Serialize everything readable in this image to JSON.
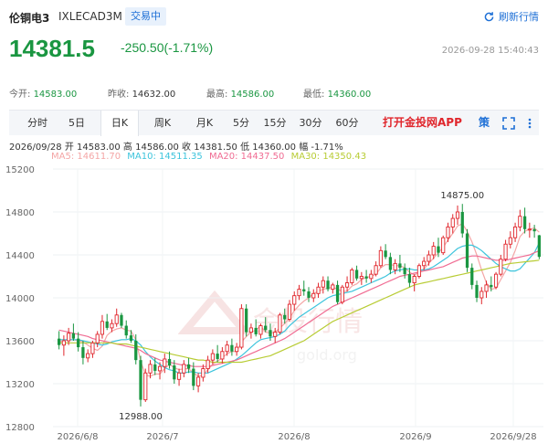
{
  "header": {
    "name": "伦铜电3",
    "code": "IXLECAD3M",
    "status": "交易中",
    "refresh_label": "刷新行情",
    "price": "14381.5",
    "change": "-250.50(-1.71%)",
    "time": "2026-09-28 15:40:43"
  },
  "stats": [
    {
      "label": "今开:",
      "value": "14583.00",
      "color": "#1a9641"
    },
    {
      "label": "昨收:",
      "value": "14632.00",
      "color": "#333333"
    },
    {
      "label": "最高:",
      "value": "14586.00",
      "color": "#1a9641"
    },
    {
      "label": "最低:",
      "value": "14360.00",
      "color": "#1a9641"
    }
  ],
  "tabs": [
    "分时",
    "5日",
    "日K",
    "周K",
    "月K",
    "5分",
    "15分",
    "30分",
    "60分"
  ],
  "active_tab": "日K",
  "promo": "打开金投网APP",
  "tools": {
    "strategy": "策",
    "fullscreen_icon": "expand-icon"
  },
  "ohlc": {
    "date": "2026/09/28",
    "open_label": "开",
    "open": "14583.00",
    "high_label": "高",
    "high": "14586.00",
    "close_label": "收",
    "close": "14381.50",
    "low_label": "低",
    "low": "14360.00",
    "range_label": "幅",
    "range": "-1.71%"
  },
  "ma_legend": [
    {
      "label": "MA5: 14611.70",
      "color": "#f4a6a6"
    },
    {
      "label": "MA10: 14511.35",
      "color": "#3cc4dc"
    },
    {
      "label": "MA20: 14437.50",
      "color": "#f06c93"
    },
    {
      "label": "MA30: 14350.43",
      "color": "#b8cc34"
    }
  ],
  "watermark": {
    "text": "金投行情",
    "url": "gold.org"
  },
  "colors": {
    "up": "#e0262c",
    "down": "#1a9641",
    "accent": "#1d6fd6"
  },
  "chart_data": {
    "type": "candlestick",
    "ylim": [
      12800,
      15200
    ],
    "y_ticks": [
      12800,
      13200,
      13600,
      14000,
      14400,
      14800,
      15200
    ],
    "x_labels": [
      "2026/6/8",
      "2026/7",
      "2026/8",
      "2026/9",
      "2026/9/28"
    ],
    "annotations": [
      {
        "label": "14875.00",
        "candle": 84
      },
      {
        "label": "12988.00",
        "candle": 17
      }
    ],
    "candles": [
      {
        "o": 13620,
        "h": 13690,
        "l": 13520,
        "c": 13560
      },
      {
        "o": 13560,
        "h": 13650,
        "l": 13460,
        "c": 13600
      },
      {
        "o": 13600,
        "h": 13720,
        "l": 13560,
        "c": 13670
      },
      {
        "o": 13670,
        "h": 13760,
        "l": 13600,
        "c": 13620
      },
      {
        "o": 13620,
        "h": 13680,
        "l": 13500,
        "c": 13540
      },
      {
        "o": 13540,
        "h": 13600,
        "l": 13380,
        "c": 13440
      },
      {
        "o": 13440,
        "h": 13520,
        "l": 13400,
        "c": 13480
      },
      {
        "o": 13480,
        "h": 13600,
        "l": 13440,
        "c": 13580
      },
      {
        "o": 13580,
        "h": 13690,
        "l": 13540,
        "c": 13660
      },
      {
        "o": 13660,
        "h": 13840,
        "l": 13620,
        "c": 13780
      },
      {
        "o": 13780,
        "h": 13850,
        "l": 13700,
        "c": 13720
      },
      {
        "o": 13720,
        "h": 13800,
        "l": 13680,
        "c": 13760
      },
      {
        "o": 13760,
        "h": 13900,
        "l": 13730,
        "c": 13840
      },
      {
        "o": 13840,
        "h": 13860,
        "l": 13720,
        "c": 13740
      },
      {
        "o": 13740,
        "h": 13790,
        "l": 13620,
        "c": 13650
      },
      {
        "o": 13650,
        "h": 13700,
        "l": 13580,
        "c": 13600
      },
      {
        "o": 13600,
        "h": 13660,
        "l": 13380,
        "c": 13420
      },
      {
        "o": 13420,
        "h": 13460,
        "l": 12988,
        "c": 13050
      },
      {
        "o": 13050,
        "h": 13340,
        "l": 13030,
        "c": 13300
      },
      {
        "o": 13300,
        "h": 13420,
        "l": 13250,
        "c": 13380
      },
      {
        "o": 13380,
        "h": 13440,
        "l": 13280,
        "c": 13320
      },
      {
        "o": 13320,
        "h": 13400,
        "l": 13240,
        "c": 13360
      },
      {
        "o": 13360,
        "h": 13480,
        "l": 13300,
        "c": 13430
      },
      {
        "o": 13430,
        "h": 13500,
        "l": 13340,
        "c": 13370
      },
      {
        "o": 13370,
        "h": 13420,
        "l": 13200,
        "c": 13240
      },
      {
        "o": 13240,
        "h": 13340,
        "l": 13180,
        "c": 13300
      },
      {
        "o": 13300,
        "h": 13420,
        "l": 13260,
        "c": 13380
      },
      {
        "o": 13380,
        "h": 13440,
        "l": 13300,
        "c": 13340
      },
      {
        "o": 13340,
        "h": 13400,
        "l": 13140,
        "c": 13180
      },
      {
        "o": 13180,
        "h": 13300,
        "l": 13120,
        "c": 13260
      },
      {
        "o": 13260,
        "h": 13380,
        "l": 13220,
        "c": 13340
      },
      {
        "o": 13340,
        "h": 13460,
        "l": 13300,
        "c": 13420
      },
      {
        "o": 13420,
        "h": 13520,
        "l": 13380,
        "c": 13480
      },
      {
        "o": 13480,
        "h": 13560,
        "l": 13400,
        "c": 13430
      },
      {
        "o": 13430,
        "h": 13540,
        "l": 13390,
        "c": 13500
      },
      {
        "o": 13500,
        "h": 13600,
        "l": 13460,
        "c": 13560
      },
      {
        "o": 13560,
        "h": 13620,
        "l": 13460,
        "c": 13500
      },
      {
        "o": 13500,
        "h": 13580,
        "l": 13460,
        "c": 13540
      },
      {
        "o": 13540,
        "h": 13940,
        "l": 13520,
        "c": 13900
      },
      {
        "o": 13900,
        "h": 13940,
        "l": 13640,
        "c": 13680
      },
      {
        "o": 13680,
        "h": 13760,
        "l": 13620,
        "c": 13720
      },
      {
        "o": 13720,
        "h": 13800,
        "l": 13640,
        "c": 13660
      },
      {
        "o": 13660,
        "h": 13760,
        "l": 13620,
        "c": 13740
      },
      {
        "o": 13740,
        "h": 13820,
        "l": 13680,
        "c": 13700
      },
      {
        "o": 13700,
        "h": 13760,
        "l": 13600,
        "c": 13640
      },
      {
        "o": 13640,
        "h": 13720,
        "l": 13580,
        "c": 13680
      },
      {
        "o": 13680,
        "h": 13860,
        "l": 13660,
        "c": 13840
      },
      {
        "o": 13840,
        "h": 13900,
        "l": 13760,
        "c": 13800
      },
      {
        "o": 13800,
        "h": 13980,
        "l": 13780,
        "c": 13940
      },
      {
        "o": 13940,
        "h": 14060,
        "l": 13880,
        "c": 14020
      },
      {
        "o": 14020,
        "h": 14120,
        "l": 13980,
        "c": 14080
      },
      {
        "o": 14080,
        "h": 14160,
        "l": 14020,
        "c": 14060
      },
      {
        "o": 14060,
        "h": 14100,
        "l": 13960,
        "c": 14000
      },
      {
        "o": 14000,
        "h": 14080,
        "l": 13960,
        "c": 14040
      },
      {
        "o": 14040,
        "h": 14140,
        "l": 14000,
        "c": 14100
      },
      {
        "o": 14100,
        "h": 14200,
        "l": 14040,
        "c": 14160
      },
      {
        "o": 14160,
        "h": 14200,
        "l": 14060,
        "c": 14080
      },
      {
        "o": 14080,
        "h": 14140,
        "l": 14040,
        "c": 14120
      },
      {
        "o": 14120,
        "h": 14160,
        "l": 13940,
        "c": 13960
      },
      {
        "o": 13960,
        "h": 14120,
        "l": 13940,
        "c": 14100
      },
      {
        "o": 14100,
        "h": 14200,
        "l": 14060,
        "c": 14140
      },
      {
        "o": 14140,
        "h": 14280,
        "l": 14120,
        "c": 14260
      },
      {
        "o": 14260,
        "h": 14300,
        "l": 14160,
        "c": 14180
      },
      {
        "o": 14180,
        "h": 14240,
        "l": 14120,
        "c": 14200
      },
      {
        "o": 14200,
        "h": 14260,
        "l": 14140,
        "c": 14180
      },
      {
        "o": 14180,
        "h": 14260,
        "l": 14140,
        "c": 14220
      },
      {
        "o": 14220,
        "h": 14340,
        "l": 14200,
        "c": 14300
      },
      {
        "o": 14300,
        "h": 14480,
        "l": 14280,
        "c": 14440
      },
      {
        "o": 14440,
        "h": 14500,
        "l": 14360,
        "c": 14380
      },
      {
        "o": 14380,
        "h": 14420,
        "l": 14220,
        "c": 14260
      },
      {
        "o": 14260,
        "h": 14360,
        "l": 14220,
        "c": 14320
      },
      {
        "o": 14320,
        "h": 14400,
        "l": 14240,
        "c": 14280
      },
      {
        "o": 14280,
        "h": 14320,
        "l": 14180,
        "c": 14220
      },
      {
        "o": 14220,
        "h": 14280,
        "l": 14100,
        "c": 14140
      },
      {
        "o": 14140,
        "h": 14220,
        "l": 14060,
        "c": 14200
      },
      {
        "o": 14200,
        "h": 14320,
        "l": 14180,
        "c": 14300
      },
      {
        "o": 14300,
        "h": 14380,
        "l": 14260,
        "c": 14340
      },
      {
        "o": 14340,
        "h": 14440,
        "l": 14300,
        "c": 14400
      },
      {
        "o": 14400,
        "h": 14520,
        "l": 14360,
        "c": 14480
      },
      {
        "o": 14480,
        "h": 14560,
        "l": 14380,
        "c": 14420
      },
      {
        "o": 14420,
        "h": 14580,
        "l": 14400,
        "c": 14560
      },
      {
        "o": 14560,
        "h": 14700,
        "l": 14520,
        "c": 14660
      },
      {
        "o": 14660,
        "h": 14780,
        "l": 14600,
        "c": 14740
      },
      {
        "o": 14740,
        "h": 14860,
        "l": 14680,
        "c": 14800
      },
      {
        "o": 14800,
        "h": 14875,
        "l": 14560,
        "c": 14600
      },
      {
        "o": 14600,
        "h": 14640,
        "l": 14240,
        "c": 14280
      },
      {
        "o": 14280,
        "h": 14320,
        "l": 14080,
        "c": 14120
      },
      {
        "o": 14120,
        "h": 14160,
        "l": 13960,
        "c": 14000
      },
      {
        "o": 14000,
        "h": 14100,
        "l": 13940,
        "c": 14060
      },
      {
        "o": 14060,
        "h": 14160,
        "l": 14000,
        "c": 14120
      },
      {
        "o": 14120,
        "h": 14200,
        "l": 14060,
        "c": 14100
      },
      {
        "o": 14100,
        "h": 14240,
        "l": 14080,
        "c": 14220
      },
      {
        "o": 14220,
        "h": 14400,
        "l": 14200,
        "c": 14360
      },
      {
        "o": 14360,
        "h": 14540,
        "l": 14340,
        "c": 14500
      },
      {
        "o": 14500,
        "h": 14620,
        "l": 14460,
        "c": 14560
      },
      {
        "o": 14560,
        "h": 14700,
        "l": 14520,
        "c": 14660
      },
      {
        "o": 14660,
        "h": 14820,
        "l": 14620,
        "c": 14760
      },
      {
        "o": 14760,
        "h": 14840,
        "l": 14600,
        "c": 14640
      },
      {
        "o": 14640,
        "h": 14700,
        "l": 14560,
        "c": 14640
      },
      {
        "o": 14640,
        "h": 14680,
        "l": 14560,
        "c": 14620
      },
      {
        "o": 14583,
        "h": 14586,
        "l": 14360,
        "c": 14381.5
      }
    ],
    "series": [
      {
        "name": "MA5",
        "values": [
          13590,
          13600,
          13610,
          13610,
          13600,
          13590,
          13560,
          13530,
          13510,
          13550,
          13650,
          13690,
          13710,
          13720,
          13700,
          13690,
          13610,
          13410,
          13280,
          13270,
          13290,
          13290,
          13340,
          13380,
          13350,
          13330,
          13340,
          13340,
          13300,
          13270,
          13280,
          13330,
          13380,
          13410,
          13440,
          13480,
          13500,
          13500,
          13590,
          13640,
          13680,
          13700,
          13740,
          13680,
          13670,
          13680,
          13720,
          13760,
          13810,
          13880,
          13930,
          13970,
          14000,
          14040,
          14060,
          14080,
          14090,
          14100,
          14080,
          14060,
          14060,
          14110,
          14130,
          14170,
          14190,
          14200,
          14220,
          14280,
          14310,
          14310,
          14300,
          14300,
          14280,
          14240,
          14210,
          14240,
          14270,
          14320,
          14370,
          14420,
          14470,
          14540,
          14600,
          14670,
          14690,
          14620,
          14520,
          14400,
          14260,
          14140,
          14080,
          14090,
          14170,
          14250,
          14330,
          14440,
          14570,
          14620,
          14640,
          14650,
          14610.7
        ]
      },
      {
        "name": "MA10",
        "values": [
          13610,
          13610,
          13610,
          13610,
          13610,
          13600,
          13590,
          13580,
          13570,
          13560,
          13570,
          13590,
          13600,
          13610,
          13610,
          13620,
          13600,
          13560,
          13500,
          13450,
          13410,
          13380,
          13350,
          13330,
          13320,
          13300,
          13300,
          13310,
          13310,
          13300,
          13300,
          13300,
          13320,
          13340,
          13360,
          13380,
          13400,
          13430,
          13460,
          13500,
          13540,
          13580,
          13610,
          13620,
          13630,
          13640,
          13660,
          13690,
          13740,
          13780,
          13820,
          13850,
          13880,
          13910,
          13940,
          13970,
          14000,
          14020,
          14030,
          14040,
          14050,
          14060,
          14080,
          14100,
          14120,
          14140,
          14160,
          14180,
          14200,
          14230,
          14250,
          14260,
          14270,
          14270,
          14260,
          14260,
          14260,
          14270,
          14290,
          14320,
          14350,
          14380,
          14420,
          14460,
          14480,
          14490,
          14490,
          14470,
          14440,
          14400,
          14360,
          14320,
          14290,
          14270,
          14250,
          14250,
          14270,
          14320,
          14370,
          14420,
          14511.35
        ]
      },
      {
        "name": "MA20",
        "values": [
          13700,
          13690,
          13680,
          13670,
          13660,
          13650,
          13640,
          13620,
          13610,
          13600,
          13590,
          13580,
          13570,
          13560,
          13550,
          13540,
          13530,
          13510,
          13480,
          13460,
          13440,
          13420,
          13410,
          13400,
          13390,
          13380,
          13370,
          13370,
          13360,
          13360,
          13360,
          13360,
          13370,
          13380,
          13390,
          13400,
          13410,
          13420,
          13440,
          13460,
          13480,
          13500,
          13520,
          13540,
          13560,
          13580,
          13600,
          13620,
          13650,
          13680,
          13710,
          13740,
          13770,
          13800,
          13830,
          13860,
          13890,
          13920,
          13940,
          13960,
          13980,
          14000,
          14020,
          14040,
          14060,
          14080,
          14100,
          14120,
          14140,
          14160,
          14180,
          14200,
          14210,
          14220,
          14230,
          14240,
          14250,
          14260,
          14270,
          14280,
          14290,
          14310,
          14330,
          14350,
          14370,
          14380,
          14390,
          14390,
          14380,
          14370,
          14360,
          14350,
          14350,
          14350,
          14360,
          14370,
          14380,
          14390,
          14400,
          14420,
          14437.5
        ]
      },
      {
        "name": "MA30",
        "values": [
          13580,
          13580,
          13580,
          13580,
          13580,
          13580,
          13580,
          13580,
          13580,
          13580,
          13580,
          13580,
          13570,
          13570,
          13570,
          13560,
          13550,
          13540,
          13530,
          13520,
          13510,
          13500,
          13490,
          13480,
          13470,
          13460,
          13450,
          13440,
          13430,
          13420,
          13420,
          13410,
          13400,
          13400,
          13400,
          13400,
          13400,
          13400,
          13400,
          13410,
          13420,
          13430,
          13440,
          13450,
          13460,
          13480,
          13500,
          13520,
          13540,
          13560,
          13580,
          13600,
          13630,
          13660,
          13690,
          13720,
          13750,
          13780,
          13800,
          13820,
          13840,
          13860,
          13880,
          13900,
          13920,
          13940,
          13960,
          13980,
          14000,
          14020,
          14040,
          14060,
          14080,
          14100,
          14120,
          14130,
          14140,
          14150,
          14160,
          14170,
          14180,
          14190,
          14200,
          14210,
          14220,
          14230,
          14240,
          14250,
          14260,
          14270,
          14280,
          14290,
          14300,
          14310,
          14320,
          14325,
          14330,
          14335,
          14340,
          14345,
          14350.43
        ]
      }
    ]
  }
}
